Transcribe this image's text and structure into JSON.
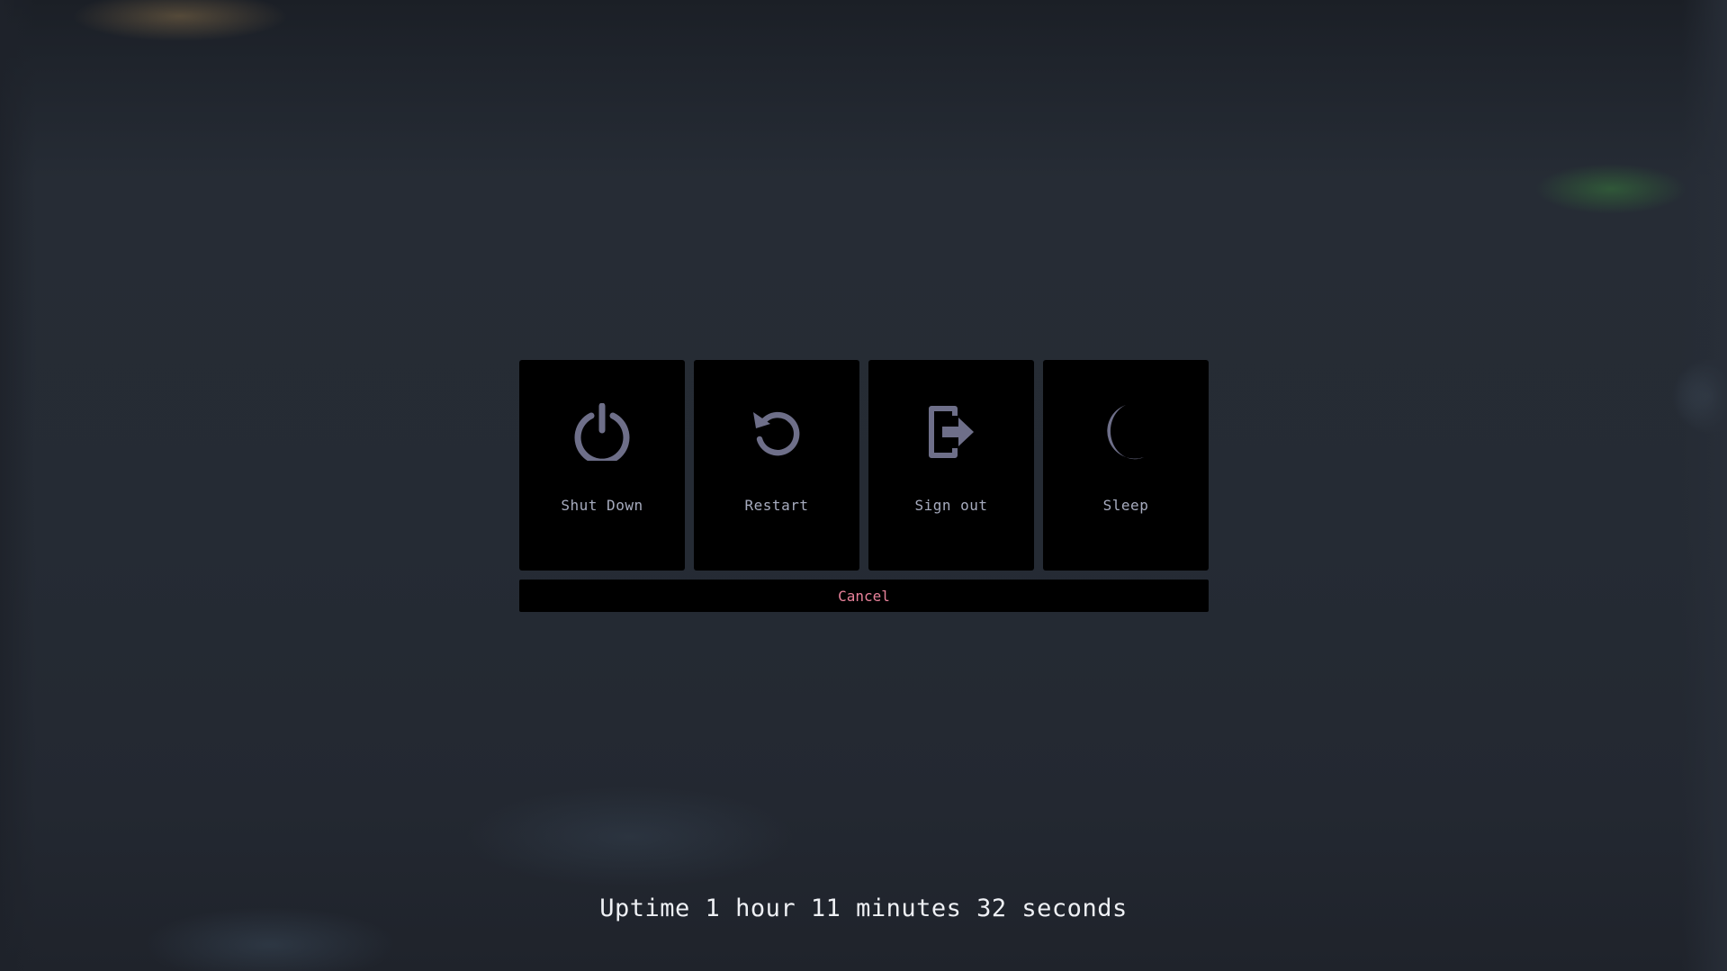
{
  "power_menu": {
    "options": [
      {
        "label": "Shut Down",
        "icon": "power-icon"
      },
      {
        "label": "Restart",
        "icon": "restart-icon"
      },
      {
        "label": "Sign out",
        "icon": "sign-out-icon"
      },
      {
        "label": "Sleep",
        "icon": "moon-icon"
      }
    ],
    "cancel_label": "Cancel",
    "colors": {
      "icon": "#6e6f89",
      "label": "#a7acbf",
      "cancel": "#e9829b",
      "tile_bg": "#000000"
    }
  },
  "uptime_text": "Uptime 1 hour 11 minutes 32 seconds"
}
